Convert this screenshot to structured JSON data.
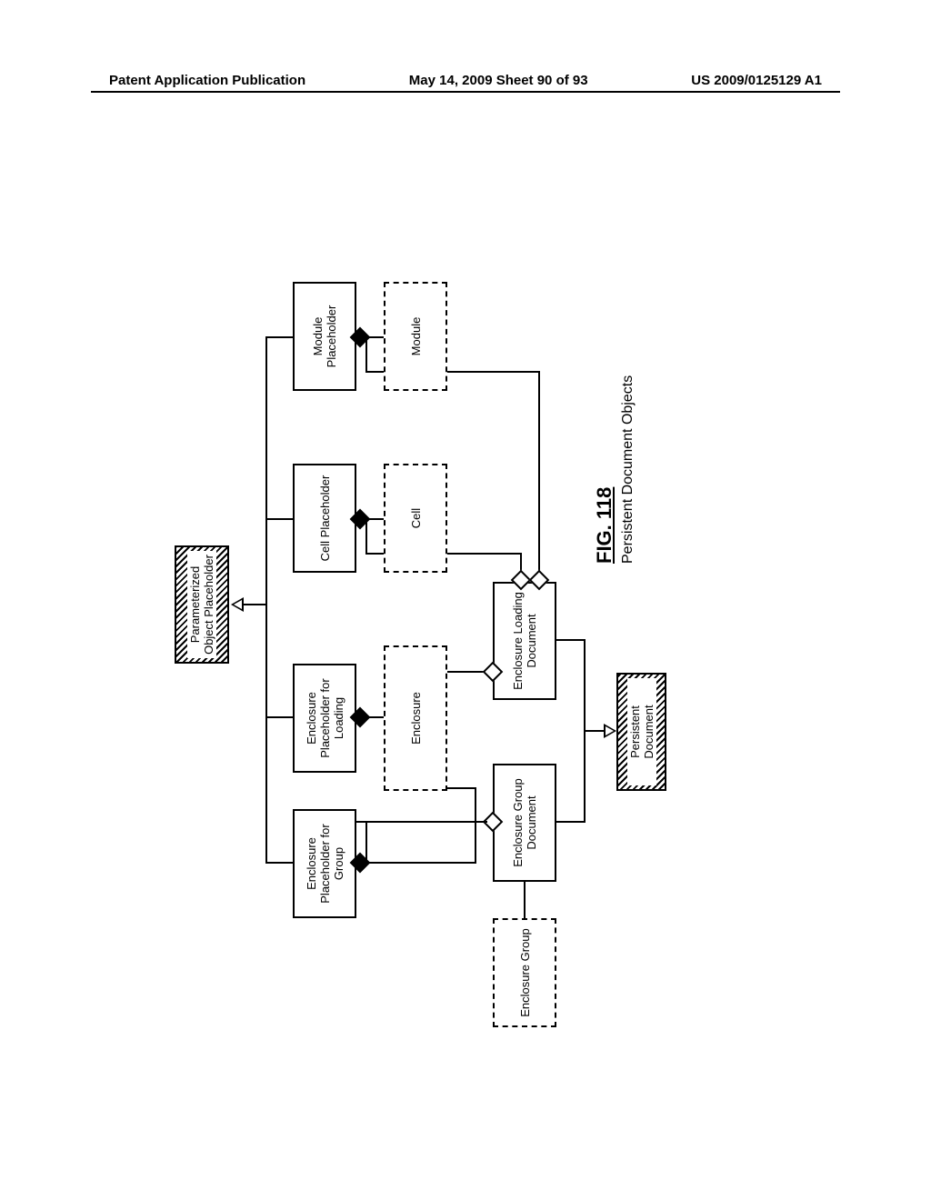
{
  "header": {
    "left": "Patent Application Publication",
    "center": "May 14, 2009  Sheet 90 of 93",
    "right": "US 2009/0125129 A1"
  },
  "boxes": {
    "parameterizedObjectPlaceholder": "Parameterized Object Placeholder",
    "enclosurePlaceholderForGroup": "Enclosure Placeholder for Group",
    "enclosurePlaceholderForLoading": "Enclosure Placeholder for Loading",
    "cellPlaceholder": "Cell Placeholder",
    "modulePlaceholder": "Module Placeholder",
    "enclosure": "Enclosure",
    "cell": "Cell",
    "module": "Module",
    "enclosureGroup": "Enclosure Group",
    "enclosureGroupDocument": "Enclosure Group Document",
    "enclosureLoadingDocument": "Enclosure Loading Document",
    "persistentDocument": "Persistent Document"
  },
  "figure": {
    "label": "FIG. 118",
    "subtitle": "Persistent Document Objects"
  }
}
